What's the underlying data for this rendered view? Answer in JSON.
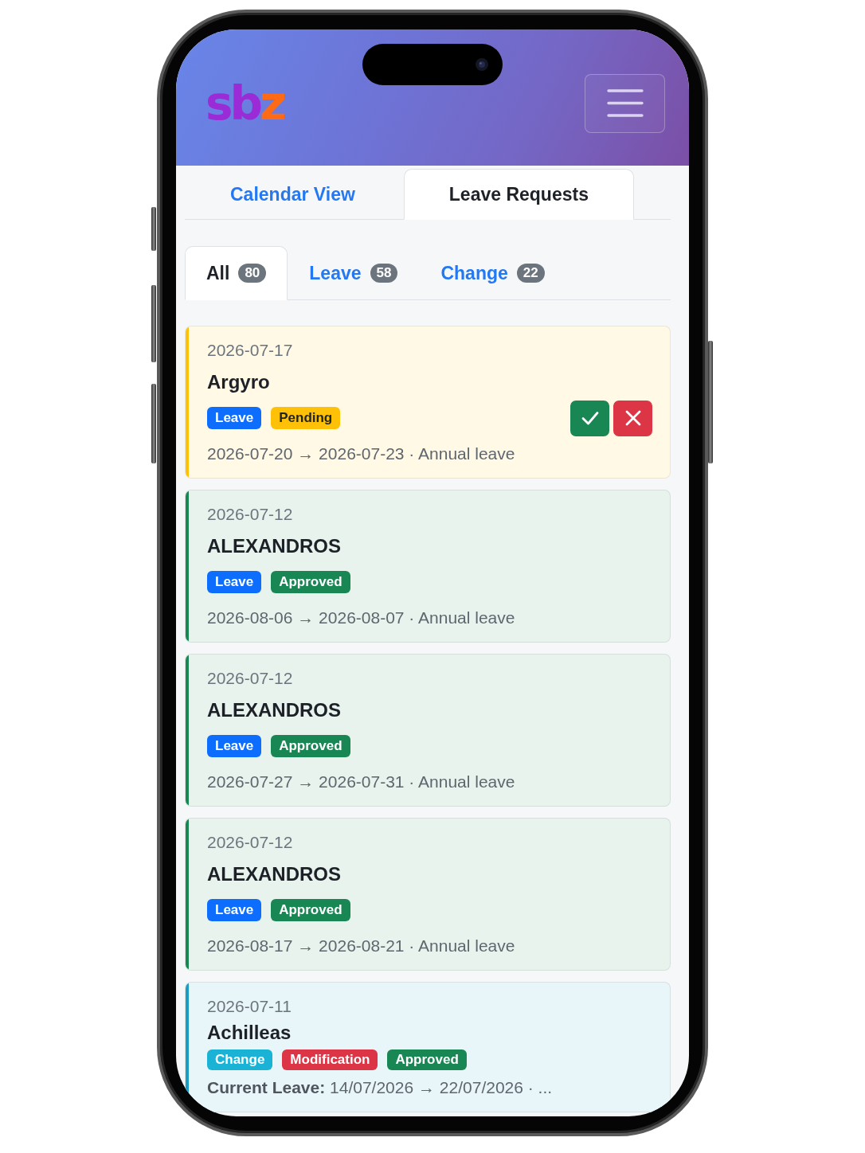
{
  "header": {
    "logo": "sbz"
  },
  "view_tabs": [
    {
      "label": "Calendar View",
      "selected": false
    },
    {
      "label": "Leave Requests",
      "selected": true
    }
  ],
  "filter_tabs": [
    {
      "label": "All",
      "count": "80",
      "selected": true
    },
    {
      "label": "Leave",
      "count": "58",
      "selected": false
    },
    {
      "label": "Change",
      "count": "22",
      "selected": false
    }
  ],
  "requests": [
    {
      "kind": "leave",
      "color": "#ffc107",
      "date": "2026-07-17",
      "name": "Argyro",
      "badges": [
        {
          "text": "Leave",
          "color": "#0d6efd"
        },
        {
          "text": "Pending",
          "color": "#ffc107"
        }
      ],
      "actions": [
        {
          "kind": "approve"
        },
        {
          "kind": "reject"
        }
      ],
      "details": "2026-07-20 → 2026-07-23 · Annual leave"
    },
    {
      "kind": "leave",
      "color": "#198754",
      "date": "2026-07-12",
      "name": "ALEXANDROS",
      "badges": [
        {
          "text": "Leave",
          "color": "#0d6efd"
        },
        {
          "text": "Approved",
          "color": "#198754"
        }
      ],
      "details": "2026-08-06 → 2026-08-07 · Annual leave"
    },
    {
      "kind": "leave",
      "color": "#198754",
      "date": "2026-07-12",
      "name": "ALEXANDROS",
      "badges": [
        {
          "text": "Leave",
          "color": "#0d6efd"
        },
        {
          "text": "Approved",
          "color": "#198754"
        }
      ],
      "details": "2026-07-27 → 2026-07-31 · Annual leave"
    },
    {
      "kind": "leave",
      "color": "#198754",
      "date": "2026-07-12",
      "name": "ALEXANDROS",
      "badges": [
        {
          "text": "Leave",
          "color": "#0d6efd"
        },
        {
          "text": "Approved",
          "color": "#198754"
        }
      ],
      "details": "2026-08-17 → 2026-08-21 · Annual leave"
    },
    {
      "kind": "change",
      "color": "#1a9dc2",
      "date": "2026-07-11",
      "name": "Achilleas",
      "badges": [
        {
          "text": "Change",
          "color": "#1ab3d5"
        },
        {
          "text": "Modification",
          "color": "#dc3545"
        },
        {
          "text": "Approved",
          "color": "#198754"
        }
      ],
      "details": "**Current Leave:** 14/07/2026 → 22/07/2026 · ..."
    }
  ]
}
